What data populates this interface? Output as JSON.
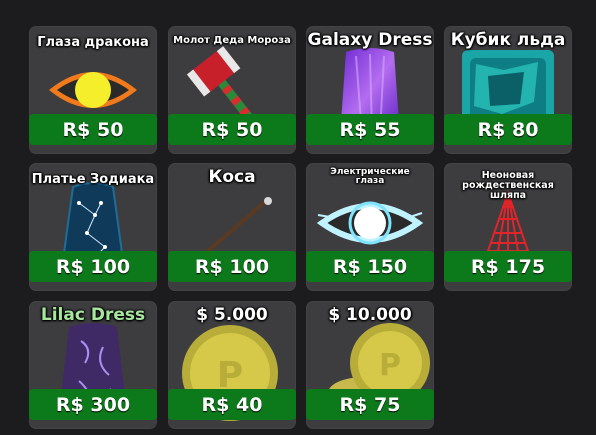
{
  "shop": {
    "items": [
      {
        "title": "Глаза дракона",
        "price": "R$ 50",
        "icon": "dragon-eye-icon"
      },
      {
        "title": "Молот Деда Мороза",
        "price": "R$ 50",
        "icon": "santa-hammer-icon"
      },
      {
        "title": "Galaxy Dress",
        "price": "R$ 55",
        "icon": "galaxy-dress-icon"
      },
      {
        "title": "Кубик льда",
        "price": "R$ 80",
        "icon": "ice-cube-icon"
      },
      {
        "title": "Платье Зодиака",
        "price": "R$ 100",
        "icon": "zodiac-dress-icon"
      },
      {
        "title": "Коса",
        "price": "R$ 100",
        "icon": "scythe-icon"
      },
      {
        "title": "Электрические глаза",
        "price": "R$ 150",
        "icon": "electric-eye-icon"
      },
      {
        "title": "Неоновая рождественская шляпа",
        "price": "R$ 175",
        "icon": "neon-christmas-hat-icon"
      },
      {
        "title": "Lilac Dress",
        "price": "R$ 300",
        "icon": "lilac-dress-icon"
      },
      {
        "title": "$ 5.000",
        "price": "R$ 40",
        "icon": "coin-icon"
      },
      {
        "title": "$ 10.000",
        "price": "R$ 75",
        "icon": "coin-stack-icon"
      }
    ]
  },
  "colors": {
    "background": "#1c1c1e",
    "card": "#3d3d3f",
    "price_bar": "#0c7a1a",
    "lilac_title": "#a8e6a0"
  }
}
